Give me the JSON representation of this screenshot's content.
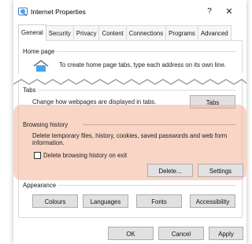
{
  "window": {
    "title": "Internet Properties",
    "help": "?",
    "close": "✕"
  },
  "tabs": [
    "General",
    "Security",
    "Privacy",
    "Content",
    "Connections",
    "Programs",
    "Advanced"
  ],
  "home_page": {
    "label": "Home page",
    "text": "To create home page tabs, type each address on its own line."
  },
  "tabs_group": {
    "label": "Tabs",
    "text": "Change how webpages are displayed in tabs.",
    "button": "Tabs"
  },
  "browsing_history": {
    "label": "Browsing history",
    "text": "Delete temporary files, history, cookies, saved passwords and web form information.",
    "checkbox_label": "Delete browsing history on exit",
    "delete_button": "Delete...",
    "settings_button": "Settings"
  },
  "appearance": {
    "label": "Appearance",
    "buttons": [
      "Colours",
      "Languages",
      "Fonts",
      "Accessibility"
    ]
  },
  "footer": {
    "ok": "OK",
    "cancel": "Cancel",
    "apply": "Apply"
  },
  "colors": {
    "highlight": "#f4b396",
    "button_face": "#e1e1e1",
    "button_border": "#adadad"
  }
}
